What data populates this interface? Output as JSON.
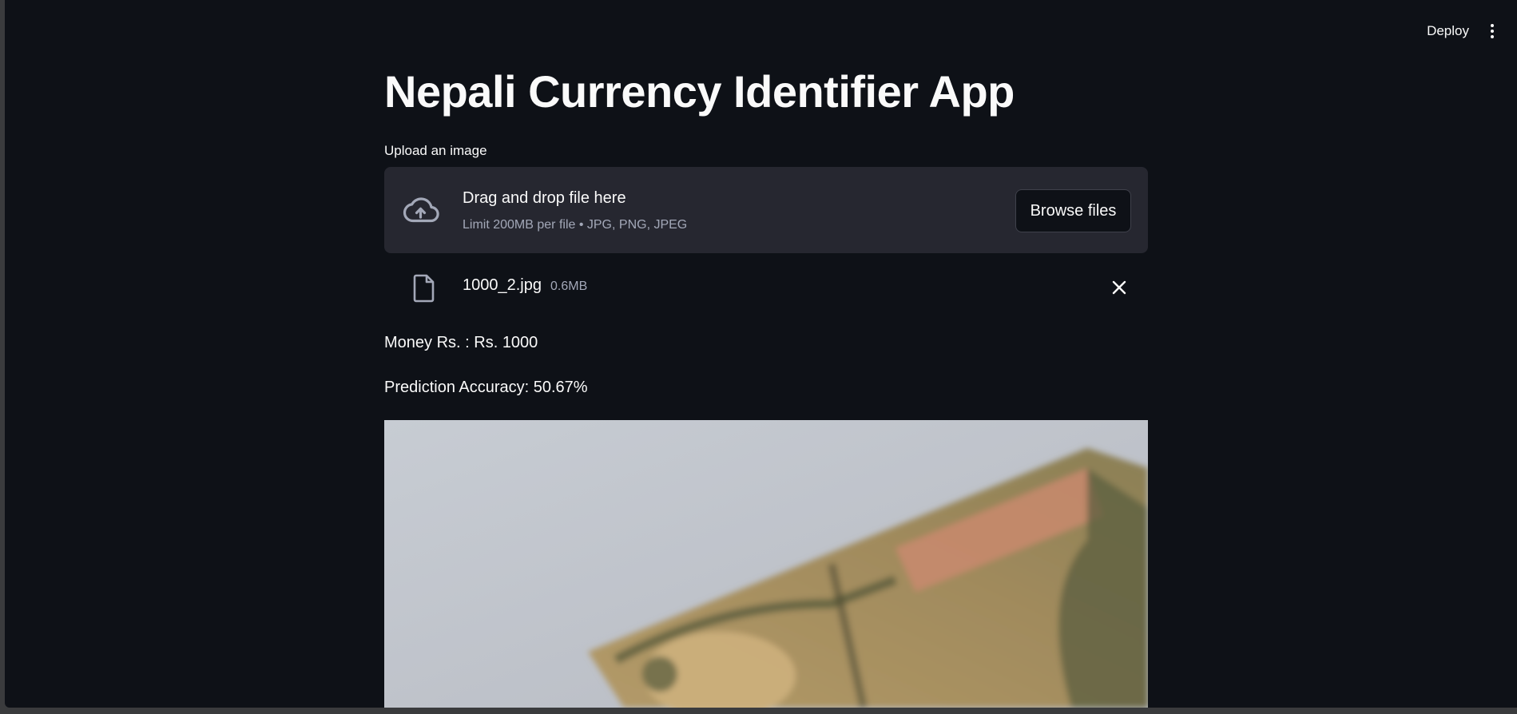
{
  "header": {
    "deploy_label": "Deploy",
    "menu_icon": "kebab-menu-icon"
  },
  "main": {
    "title": "Nepali Currency Identifier App",
    "uploader": {
      "label": "Upload an image",
      "drop_text": "Drag and drop file here",
      "limit_text": "Limit 200MB per file • JPG, PNG, JPEG",
      "browse_label": "Browse files",
      "icon": "cloud-upload-icon"
    },
    "file": {
      "name": "1000_2.jpg",
      "size": "0.6MB",
      "icon": "file-icon",
      "remove_icon": "close-icon"
    },
    "result": {
      "money": "Money Rs. : Rs. 1000",
      "accuracy": "Prediction Accuracy: 50.67%"
    }
  },
  "colors": {
    "background": "#0e1117",
    "dropzone": "#262730",
    "text": "#fafafa",
    "muted_text": "#a3a8b8"
  }
}
